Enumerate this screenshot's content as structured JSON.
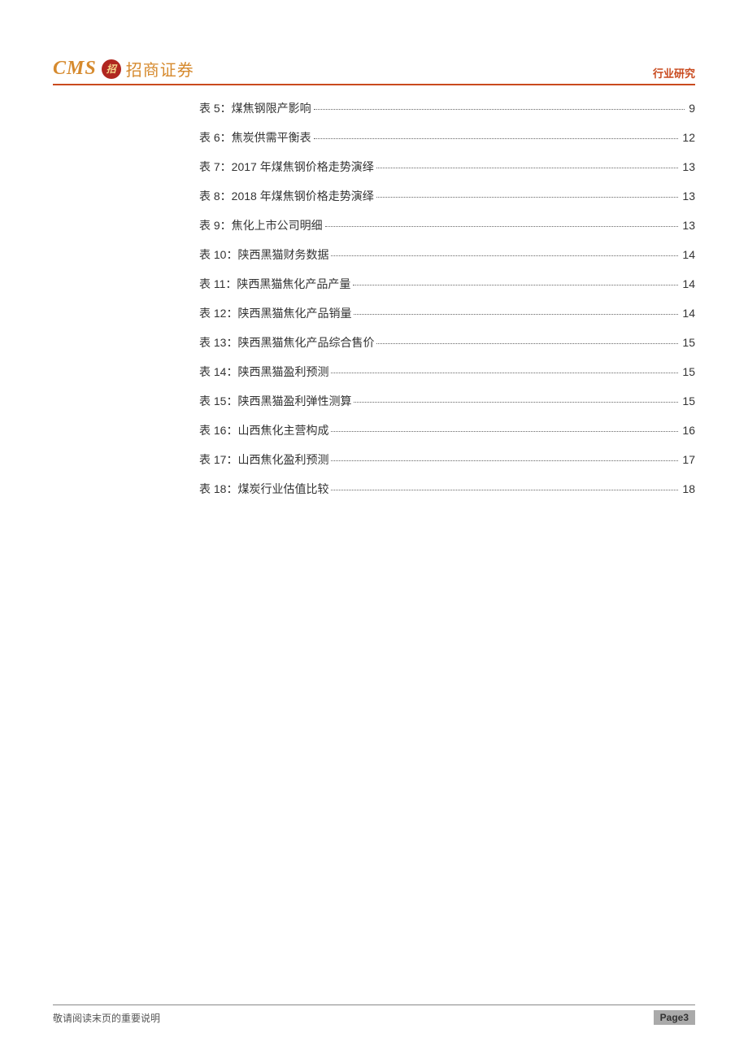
{
  "header": {
    "logo_cms": "CMS",
    "logo_inner": "招",
    "logo_cn": "招商证券",
    "right_label": "行业研究"
  },
  "toc": [
    {
      "label": "表 5：煤焦钢限产影响",
      "page": "9"
    },
    {
      "label": "表 6：焦炭供需平衡表",
      "page": "12"
    },
    {
      "label": "表 7：2017 年煤焦钢价格走势演绎",
      "page": "13"
    },
    {
      "label": "表 8：2018 年煤焦钢价格走势演绎",
      "page": "13"
    },
    {
      "label": "表 9：焦化上市公司明细",
      "page": "13"
    },
    {
      "label": "表 10：陕西黑猫财务数据",
      "page": "14"
    },
    {
      "label": "表 11：陕西黑猫焦化产品产量",
      "page": "14"
    },
    {
      "label": "表 12：陕西黑猫焦化产品销量",
      "page": "14"
    },
    {
      "label": "表 13：陕西黑猫焦化产品综合售价",
      "page": "15"
    },
    {
      "label": "表 14：陕西黑猫盈利预测",
      "page": "15"
    },
    {
      "label": "表 15：陕西黑猫盈利弹性测算",
      "page": "15"
    },
    {
      "label": "表 16：山西焦化主营构成",
      "page": "16"
    },
    {
      "label": "表 17：山西焦化盈利预测",
      "page": "17"
    },
    {
      "label": "表 18：煤炭行业估值比较",
      "page": "18"
    }
  ],
  "footer": {
    "disclaimer": "敬请阅读末页的重要说明",
    "page_label": "Page3"
  }
}
